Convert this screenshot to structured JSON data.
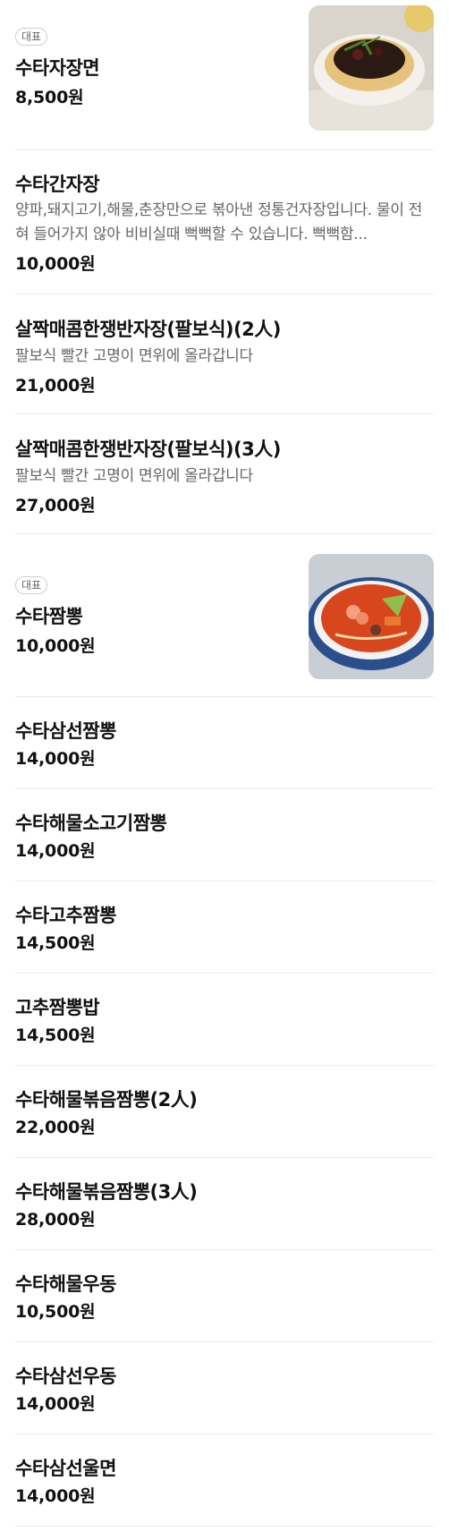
{
  "menu": {
    "items": [
      {
        "badge": "대표",
        "name": "수타자장면",
        "price": "8,500원",
        "image": "jajangmyeon-photo"
      },
      {
        "name": "수타간자장",
        "desc": "양파,돼지고기,해물,춘장만으로 볶아낸 정통건자장입니다. 물이 전혀 들어가지 않아 비비실때 뻑뻑할 수 있습니다. 뻑뻑함...",
        "price": "10,000원"
      },
      {
        "name": "살짝매콤한쟁반자장(팔보식)(2人)",
        "desc": "팔보식 빨간 고명이 면위에 올라갑니다",
        "price": "21,000원"
      },
      {
        "name": "살짝매콤한쟁반자장(팔보식)(3人)",
        "desc": "팔보식 빨간 고명이 면위에 올라갑니다",
        "price": "27,000원"
      },
      {
        "badge": "대표",
        "name": "수타짬뽕",
        "price": "10,000원",
        "image": "jjamppong-photo"
      },
      {
        "name": "수타삼선짬뽕",
        "price": "14,000원"
      },
      {
        "name": "수타해물소고기짬뽕",
        "price": "14,000원"
      },
      {
        "name": "수타고추짬뽕",
        "price": "14,500원"
      },
      {
        "name": "고추짬뽕밥",
        "price": "14,500원"
      },
      {
        "name": "수타해물볶음짬뽕(2人)",
        "price": "22,000원"
      },
      {
        "name": "수타해물볶음짬뽕(3人)",
        "price": "28,000원"
      },
      {
        "name": "수타해물우동",
        "price": "10,500원"
      },
      {
        "name": "수타삼선우동",
        "price": "14,000원"
      },
      {
        "name": "수타삼선울면",
        "price": "14,000원"
      }
    ]
  }
}
